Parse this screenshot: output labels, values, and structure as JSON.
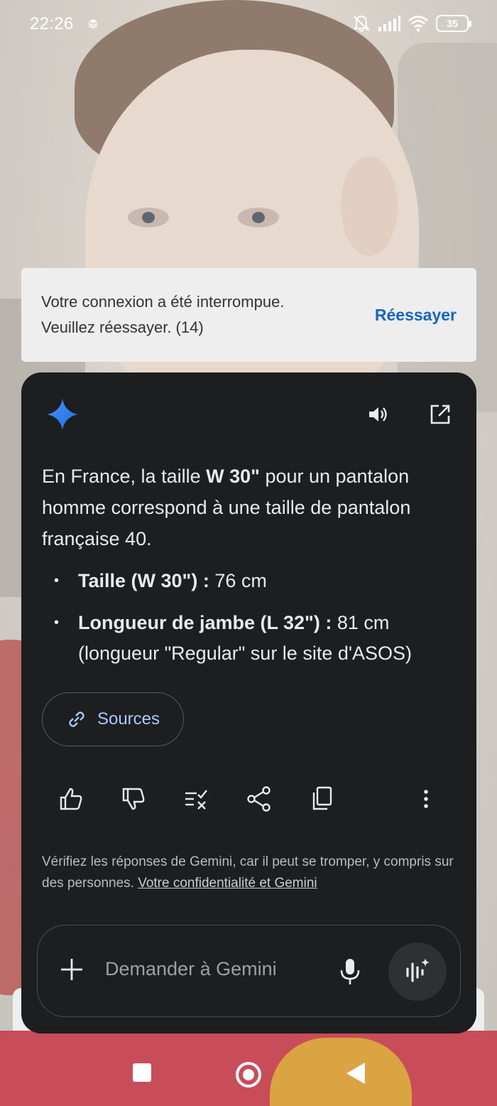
{
  "status_bar": {
    "time": "22:26",
    "battery": "35"
  },
  "snackbar": {
    "message_line1": "Votre connexion a été interrompue.",
    "message_line2": "Veuillez réessayer. (14)",
    "retry_label": "Réessayer"
  },
  "card": {
    "answer": {
      "part1": "En France, la taille ",
      "bold": "W 30\"",
      "part2": " pour un pantalon homme correspond à une taille de pantalon française 40."
    },
    "bullets": [
      {
        "bold": "Taille (W 30\") :",
        "text": " 76 cm"
      },
      {
        "bold": "Longueur de jambe (L 32\") :",
        "text": " 81 cm (longueur \"Regular\" sur le site d'ASOS)"
      }
    ],
    "sources_label": "Sources",
    "disclaimer": "Vérifiez les réponses de Gemini, car il peut se tromper, y compris sur des personnes.",
    "privacy_link": "Votre confidentialité et Gemini"
  },
  "input": {
    "placeholder": "Demander à Gemini"
  },
  "colors": {
    "accent": "#1366c7",
    "card_bg": "#1d1e20",
    "link": "#a8c7fa",
    "gemini_star": "#1a73e8"
  }
}
